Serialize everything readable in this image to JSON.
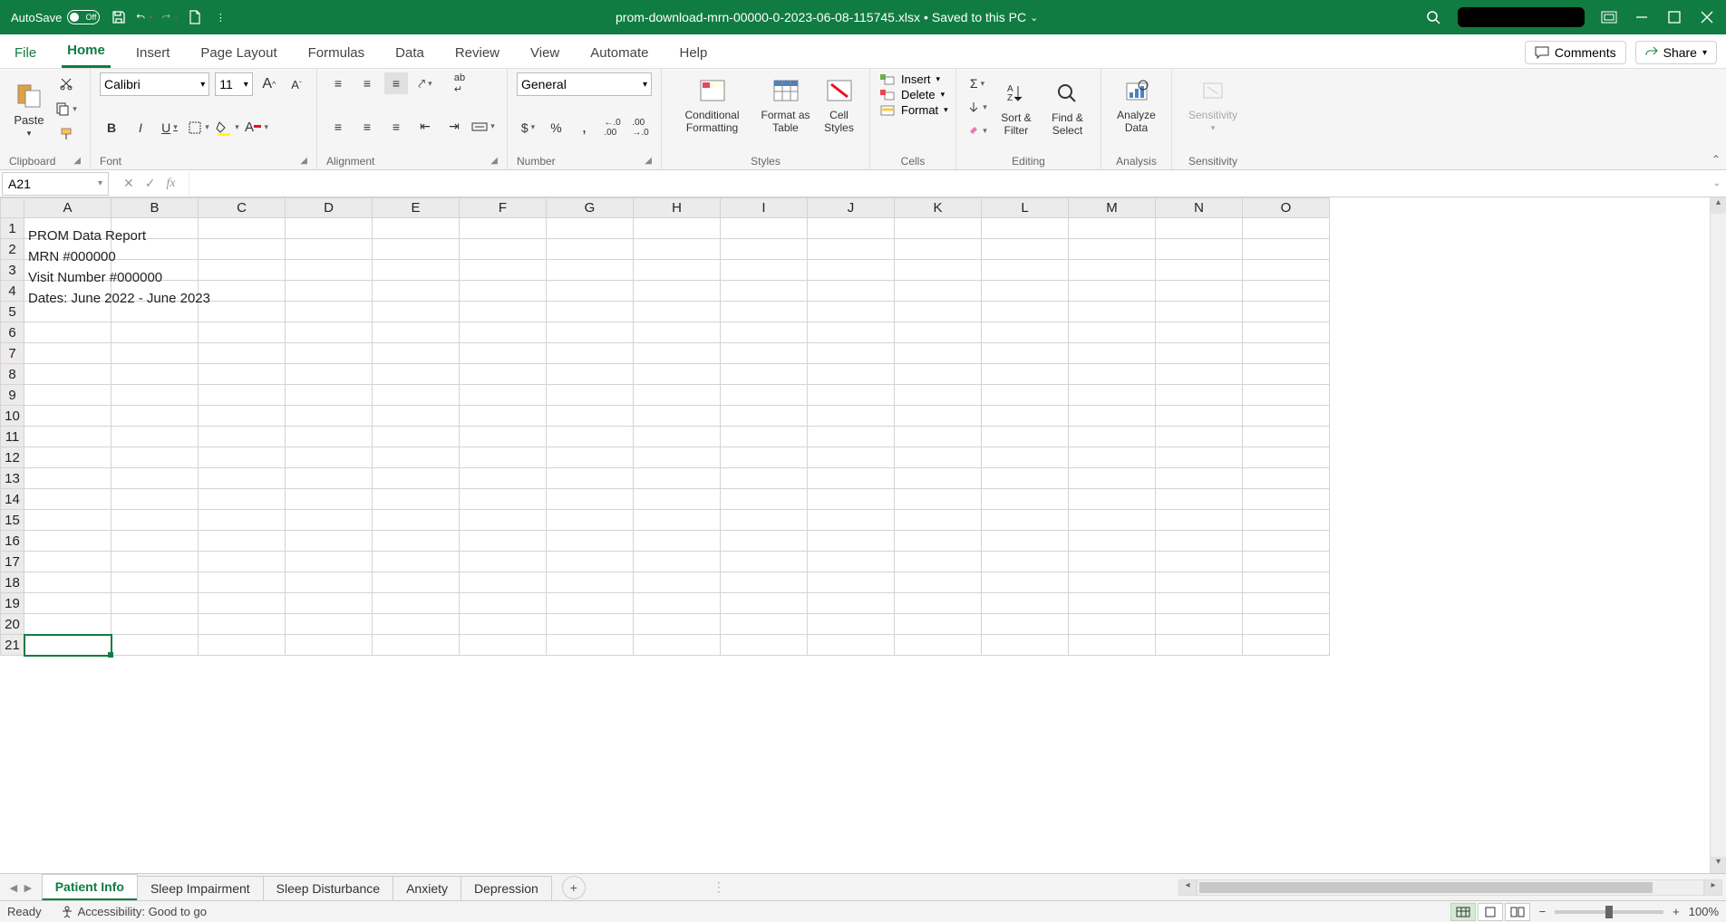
{
  "titlebar": {
    "autosave_label": "AutoSave",
    "autosave_state": "Off",
    "filename": "prom-download-mrn-00000-0-2023-06-08-115745.xlsx",
    "save_status": "Saved to this PC"
  },
  "ribbon_tabs": [
    "File",
    "Home",
    "Insert",
    "Page Layout",
    "Formulas",
    "Data",
    "Review",
    "View",
    "Automate",
    "Help"
  ],
  "ribbon_right": {
    "comments": "Comments",
    "share": "Share"
  },
  "ribbon": {
    "clipboard": {
      "paste": "Paste",
      "label": "Clipboard"
    },
    "font": {
      "name": "Calibri",
      "size": "11",
      "label": "Font"
    },
    "alignment": {
      "label": "Alignment"
    },
    "number": {
      "format": "General",
      "label": "Number"
    },
    "styles": {
      "cond": "Conditional Formatting",
      "table": "Format as Table",
      "cell": "Cell Styles",
      "label": "Styles"
    },
    "cells": {
      "insert": "Insert",
      "delete": "Delete",
      "format": "Format",
      "label": "Cells"
    },
    "editing": {
      "sort": "Sort & Filter",
      "find": "Find & Select",
      "label": "Editing"
    },
    "analysis": {
      "analyze": "Analyze Data",
      "label": "Analysis"
    },
    "sensitivity": {
      "btn": "Sensitivity",
      "label": "Sensitivity"
    }
  },
  "formula_bar": {
    "name_box": "A21",
    "formula": ""
  },
  "columns": [
    "A",
    "B",
    "C",
    "D",
    "E",
    "F",
    "G",
    "H",
    "I",
    "J",
    "K",
    "L",
    "M",
    "N",
    "O"
  ],
  "rows_count": 21,
  "cells": {
    "A1": "PROM Data Report",
    "A2": "MRN #000000",
    "A3": "Visit Number #000000",
    "A4": "Dates: June 2022 - June 2023"
  },
  "selected_cell": "A21",
  "sheet_tabs": [
    "Patient Info",
    "Sleep Impairment",
    "Sleep Disturbance",
    "Anxiety",
    "Depression"
  ],
  "active_sheet": 0,
  "status": {
    "ready": "Ready",
    "accessibility": "Accessibility: Good to go",
    "zoom": "100%"
  }
}
